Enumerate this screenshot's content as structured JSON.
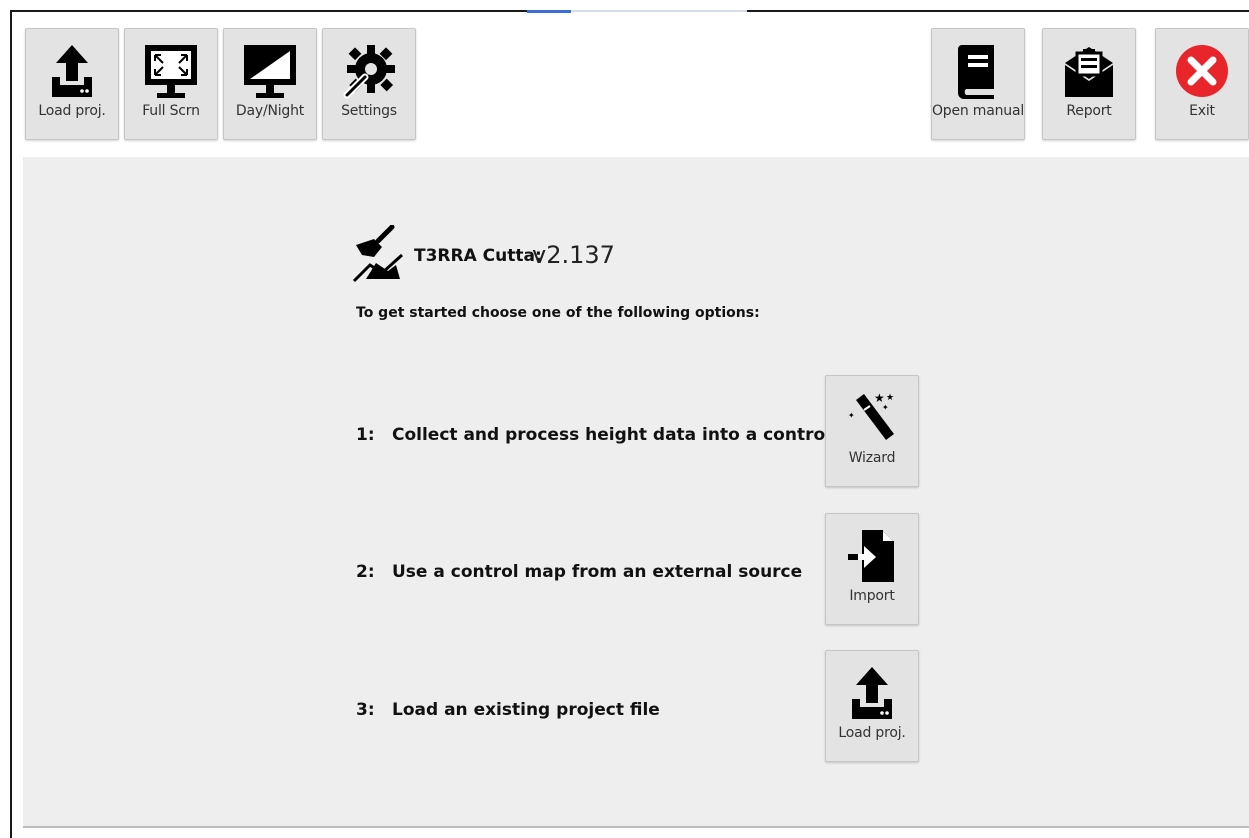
{
  "toolbar": {
    "left": [
      {
        "label": "Load proj.",
        "icon": "upload-tray-icon"
      },
      {
        "label": "Full Scrn",
        "icon": "fullscreen-monitor-icon"
      },
      {
        "label": "Day/Night",
        "icon": "day-night-monitor-icon"
      },
      {
        "label": "Settings",
        "icon": "gear-wrench-icon"
      }
    ],
    "right": [
      {
        "label": "Open manual",
        "icon": "book-icon"
      },
      {
        "label": "Report",
        "icon": "clipboard-report-icon"
      },
      {
        "label": "Exit",
        "icon": "close-circle-icon"
      }
    ]
  },
  "app": {
    "name": "T3RRA Cutta:",
    "version": "v2.137",
    "logo_icon": "excavator-bucket-icon"
  },
  "intro": "To get started choose one of the following options:",
  "options": [
    {
      "num": "1:",
      "text": "Collect and process height data into a control map",
      "button_label": "Wizard",
      "icon": "magic-wand-icon"
    },
    {
      "num": "2:",
      "text": "Use a control map from an external source",
      "button_label": "Import",
      "icon": "import-file-icon"
    },
    {
      "num": "3:",
      "text": "Load an existing project file",
      "button_label": "Load proj.",
      "icon": "upload-tray-icon"
    }
  ],
  "colors": {
    "content_bg": "#eeeeee",
    "button_bg": "#e3e3e3",
    "exit_red": "#e8252b",
    "accent_blue": "#3b6fd6"
  }
}
